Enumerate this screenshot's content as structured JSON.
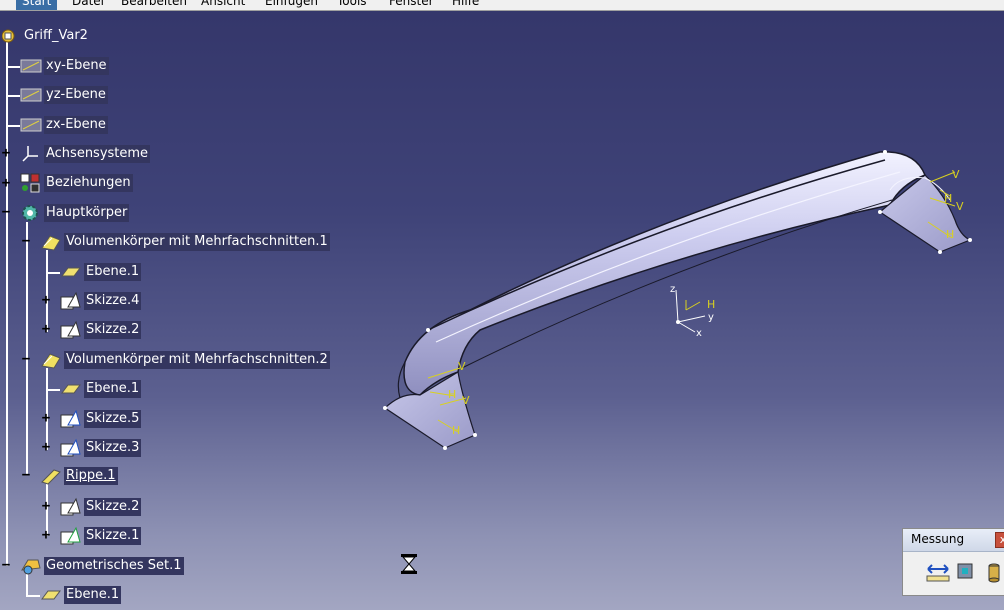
{
  "menu": {
    "items": [
      "Start",
      "Datei",
      "Bearbeiten",
      "Ansicht",
      "Einfügen",
      "Tools",
      "Fenster",
      "Hilfe"
    ]
  },
  "tree": {
    "root": "Griff_Var2",
    "planes": [
      "xy-Ebene",
      "yz-Ebene",
      "zx-Ebene"
    ],
    "axis_systems": "Achsensysteme",
    "relations": "Beziehungen",
    "main_body": "Hauptkörper",
    "multisection1": {
      "label": "Volumenkörper mit Mehrfachschnitten.1",
      "children": [
        "Ebene.1",
        "Skizze.4",
        "Skizze.2"
      ]
    },
    "multisection2": {
      "label": "Volumenkörper mit Mehrfachschnitten.2",
      "children": [
        "Ebene.1",
        "Skizze.5",
        "Skizze.3"
      ]
    },
    "rib": {
      "label": "Rippe.1",
      "children": [
        "Skizze.2",
        "Skizze.1"
      ]
    },
    "geoset": {
      "label": "Geometrisches Set.1",
      "children": [
        "Ebene.1"
      ]
    }
  },
  "measure_toolbar": {
    "title": "Messung",
    "close": "x"
  },
  "viewport": {
    "axis_labels": {
      "v": "V",
      "h": "H",
      "x": "x",
      "y": "y",
      "z": "z"
    }
  },
  "colors": {
    "background_top": "#34366a",
    "background_bottom": "#a3a6c2",
    "part": "#c7c7ea",
    "label_bg": "#34365f",
    "sketch": "#d8d020"
  }
}
